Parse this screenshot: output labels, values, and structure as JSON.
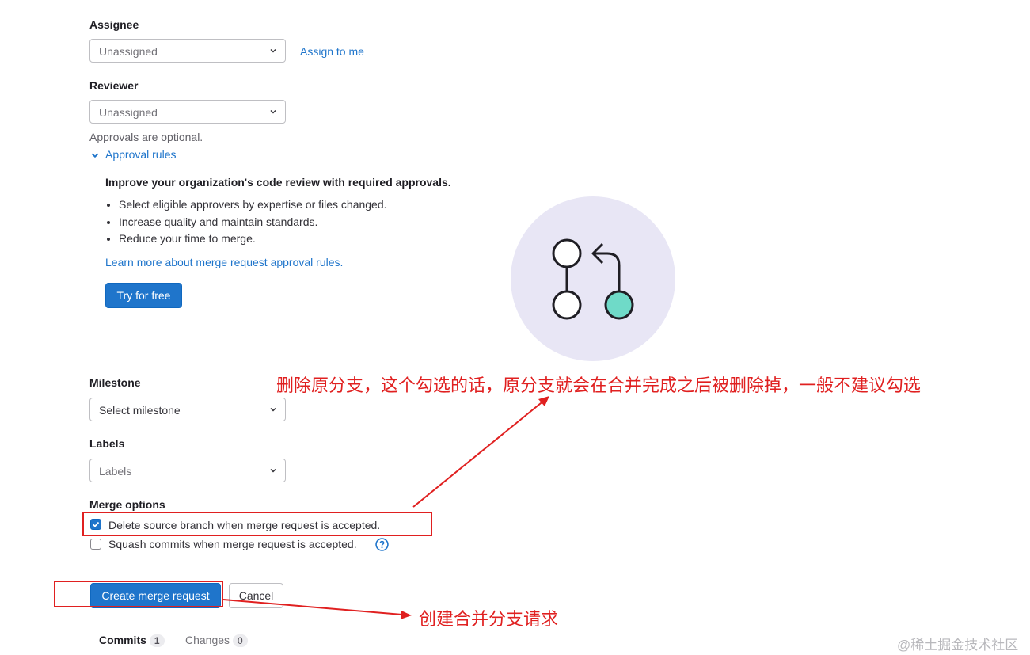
{
  "assignee": {
    "label": "Assignee",
    "select_value": "Unassigned",
    "assign_to_me": "Assign to me"
  },
  "reviewer": {
    "label": "Reviewer",
    "select_value": "Unassigned",
    "approvals_note": "Approvals are optional.",
    "approval_rules_toggle": "Approval rules"
  },
  "approval_promo": {
    "heading": "Improve your organization's code review with required approvals.",
    "bullets": [
      "Select eligible approvers by expertise or files changed.",
      "Increase quality and maintain standards.",
      "Reduce your time to merge."
    ],
    "learn_more": "Learn more about merge request approval rules.",
    "try_button": "Try for free",
    "illustration_colors": {
      "circle_bg": "#e8e6f5",
      "accent_node": "#6fdac8"
    }
  },
  "milestone": {
    "label": "Milestone",
    "select_value": "Select milestone"
  },
  "labels": {
    "label": "Labels",
    "select_value": "Labels"
  },
  "merge_options": {
    "label": "Merge options",
    "delete_source": {
      "text": "Delete source branch when merge request is accepted.",
      "checked": true
    },
    "squash": {
      "text": "Squash commits when merge request is accepted.",
      "checked": false
    }
  },
  "actions": {
    "create": "Create merge request",
    "cancel": "Cancel"
  },
  "tabs": [
    {
      "label": "Commits",
      "count": "1"
    },
    {
      "label": "Changes",
      "count": "0"
    }
  ],
  "annotations": {
    "delete_branch_note": "删除原分支，这个勾选的话，原分支就会在合并完成之后被删除掉，一般不建议勾选",
    "create_note": "创建合并分支请求"
  },
  "watermark": "@稀土掘金技术社区",
  "colors": {
    "primary": "#1f75cb",
    "annotation_red": "#e02020"
  }
}
